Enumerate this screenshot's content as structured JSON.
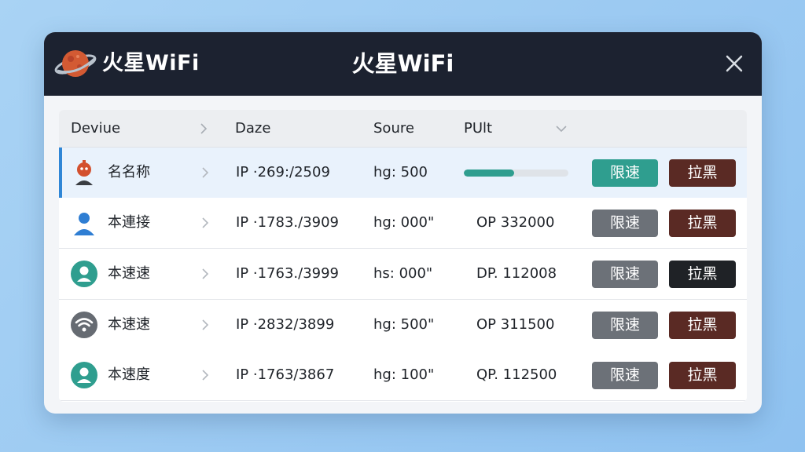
{
  "titlebar": {
    "brand": "火星WiFi",
    "title": "火星WiFi",
    "logo_icon": "planet-icon",
    "close_icon": "close-icon"
  },
  "table": {
    "headers": [
      "Deviue",
      "Daze",
      "Soure",
      "PUlt"
    ],
    "rows": [
      {
        "name": "名名称",
        "ip": "IP ·269:/2509",
        "source": "hg: 500",
        "put": "",
        "progress": 0.48,
        "avatar": "robot-avatar-icon",
        "limit_label": "限速",
        "block_label": "拉黑",
        "limit_color": "#2f9e8f",
        "block_color": "#5a2a24",
        "selected": true
      },
      {
        "name": "本連接",
        "ip": "IP ·1783./3909",
        "source": "hg: 000\"",
        "put": "OP 332000",
        "avatar": "person-avatar-icon",
        "limit_label": "限速",
        "block_label": "拉黑",
        "limit_color": "#6c7178",
        "block_color": "#5a2a24",
        "selected": false
      },
      {
        "name": "本速速",
        "ip": "IP ·1763./3999",
        "source": "hs: 000\"",
        "put": "DP. 112008",
        "avatar": "user-circle-icon",
        "limit_label": "限速",
        "block_label": "拉黑",
        "limit_color": "#6c7178",
        "block_color": "#1f2226",
        "selected": false
      },
      {
        "name": "本速速",
        "ip": "IP ·2832/3899",
        "source": "hg: 500\"",
        "put": "OP 311500",
        "avatar": "wifi-icon",
        "limit_label": "限速",
        "block_label": "拉黑",
        "limit_color": "#6c7178",
        "block_color": "#5a2a24",
        "selected": false
      },
      {
        "name": "本速度",
        "ip": "IP ·1763/3867",
        "source": "hg: 100\"",
        "put": "QP. 112500",
        "avatar": "user-circle-icon",
        "limit_label": "限速",
        "block_label": "拉黑",
        "limit_color": "#6c7178",
        "block_color": "#5a2a24",
        "selected": false
      }
    ]
  }
}
